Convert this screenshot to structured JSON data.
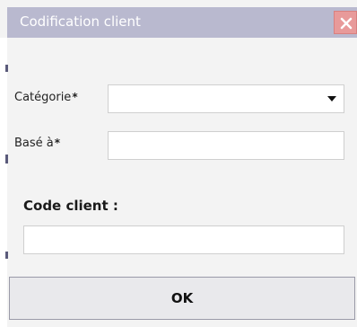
{
  "window": {
    "title": "Codification client"
  },
  "form": {
    "categorie": {
      "label": "Catégorie",
      "required_mark": "*",
      "value": ""
    },
    "base_a": {
      "label": "Basé à",
      "required_mark": "*",
      "value": ""
    },
    "code_client": {
      "label": "Code client :",
      "value": ""
    }
  },
  "buttons": {
    "ok_label": "OK"
  },
  "colors": {
    "titlebar": "#b9b9cf",
    "close_button": "#e89a9a",
    "window_background": "#f3f3f3"
  },
  "icons": {
    "close": "close-icon",
    "dropdown": "chevron-down-icon"
  }
}
